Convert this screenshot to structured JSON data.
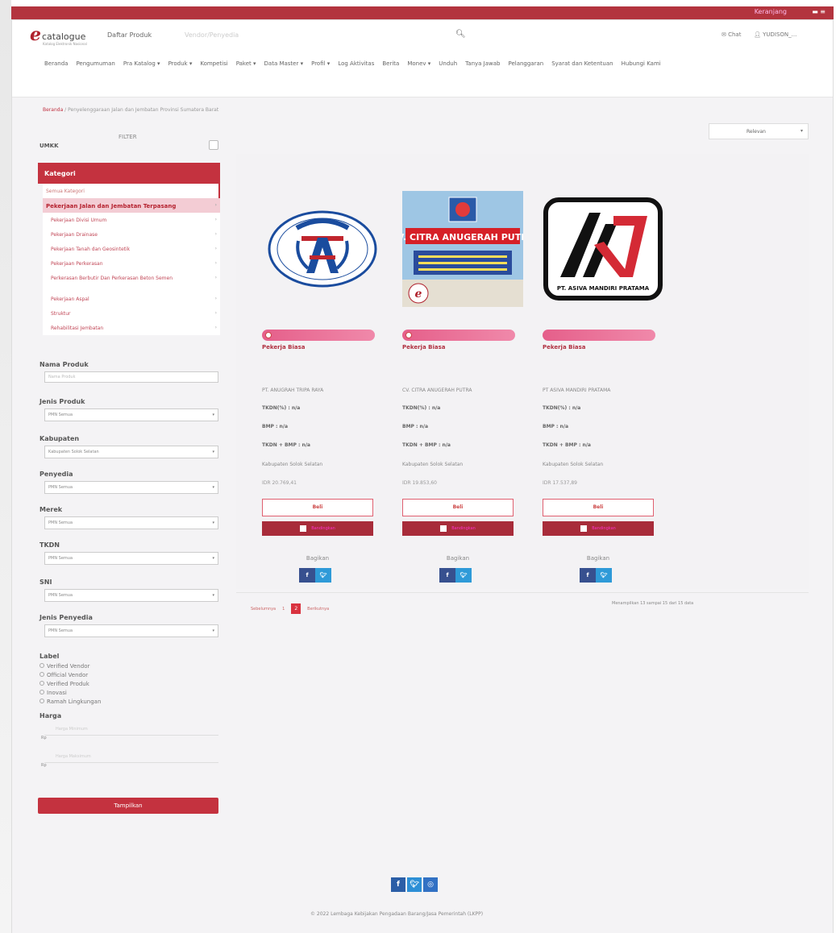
{
  "topbar": {
    "cart": "Keranjang",
    "menu": "▬ ≡"
  },
  "header": {
    "logo_e": "e",
    "logo_text": "catalogue",
    "logo_sub": "Katalog Elektronik Nasional",
    "daftar_produk": "Daftar Produk",
    "faint_link": "Vendor/Penyedia",
    "chat": "Chat",
    "user": "YUDISON_..."
  },
  "nav": [
    "Beranda",
    "Pengumuman",
    "Pra Katalog ▾",
    "Produk ▾",
    "Kompetisi",
    "Paket ▾",
    "Data Master ▾",
    "Profil ▾",
    "Log Aktivitas",
    "Berita",
    "Monev ▾",
    "Unduh",
    "Tanya Jawab",
    "Pelanggaran",
    "Syarat dan Ketentuan",
    "Hubungi Kami"
  ],
  "breadcrumb": {
    "home": "Beranda",
    "sep": " / ",
    "current": "Penyelenggaraan Jalan dan Jembatan Provinsi Sumatera Barat"
  },
  "filter": {
    "title": "FILTER",
    "umkk": "UMKK",
    "kategori_header": "Kategori",
    "kategori": [
      {
        "label": "Semua Kategori",
        "type": "all"
      },
      {
        "label": "Pekerjaan Jalan dan Jembatan Terpasang",
        "type": "selected"
      },
      {
        "label": "Pekerjaan Divisi Umum",
        "type": "sub"
      },
      {
        "label": "Pekerjaan Drainase",
        "type": "sub"
      },
      {
        "label": "Pekerjaan Tanah dan Geosintetik",
        "type": "sub"
      },
      {
        "label": "Pekerjaan Perkerasan",
        "type": "sub"
      },
      {
        "label": "Perkerasan Berbutir Dan Perkerasan Beton Semen",
        "type": "sub-two"
      },
      {
        "label": "Pekerjaan Aspal",
        "type": "sub"
      },
      {
        "label": "Struktur",
        "type": "sub"
      },
      {
        "label": "Rehabilitasi Jembatan",
        "type": "sub"
      }
    ],
    "nama_produk": {
      "label": "Nama Produk",
      "placeholder": "Nama Produk"
    },
    "jenis_produk": {
      "label": "Jenis Produk",
      "value": "PMN Semua"
    },
    "kabupaten": {
      "label": "Kabupaten",
      "value": "Kabupaten Solok Selatan"
    },
    "penyedia": {
      "label": "Penyedia",
      "value": "PMN Semua"
    },
    "merek": {
      "label": "Merek",
      "value": "PMN Semua"
    },
    "tkdn": {
      "label": "TKDN",
      "value": "PMN Semua"
    },
    "sni": {
      "label": "SNI",
      "value": "PMN Semua"
    },
    "jenis_penyedia": {
      "label": "Jenis Penyedia",
      "value": "PMN Semua"
    },
    "label": {
      "title": "Label",
      "options": [
        "Verified Vendor",
        "Official Vendor",
        "Verified Produk",
        "Inovasi",
        "Ramah Lingkungan"
      ]
    },
    "harga": {
      "title": "Harga",
      "min_placeholder": "Harga Minimum",
      "max_placeholder": "Harga Maksimum",
      "rp": "Rp"
    },
    "button": "Tampilkan"
  },
  "sort": {
    "value": "Relevan"
  },
  "products": [
    {
      "logo": "anugrah-tripa-raya-logo",
      "logo_text": "ANUGRAH TRIPA RAYA",
      "type": "Pekerja Biasa",
      "vendor": "PT. ANUGRAH TRIPA RAYA",
      "tkdn_pct": "TKDN(%) : n/a",
      "bmp": "BMP : n/a",
      "tkdn_bmp": "TKDN + BMP : n/a",
      "kabupaten": "Kabupaten Solok Selatan",
      "price": "IDR 20.769,41",
      "buy": "Beli",
      "compare": "Bandingkan",
      "share": "Bagikan"
    },
    {
      "logo": "cv-citra-anugerah-putra-logo",
      "logo_text": "CV. CITRA ANUGERAH PUTRA",
      "type": "Pekerja Biasa",
      "vendor": "CV. CITRA ANUGERAH PUTRA",
      "tkdn_pct": "TKDN(%) : n/a",
      "bmp": "BMP : n/a",
      "tkdn_bmp": "TKDN + BMP : n/a",
      "kabupaten": "Kabupaten Solok Selatan",
      "price": "IDR 19.853,60",
      "buy": "Beli",
      "compare": "Bandingkan",
      "share": "Bagikan"
    },
    {
      "logo": "pt-asiva-mandiri-pratama-logo",
      "logo_text": "PT. ASIVA MANDIRI PRATAMA",
      "type": "Pekerja Biasa",
      "vendor": "PT ASIVA MANDIRI PRATAMA",
      "tkdn_pct": "TKDN(%) : n/a",
      "bmp": "BMP : n/a",
      "tkdn_bmp": "TKDN + BMP : n/a",
      "kabupaten": "Kabupaten Solok Selatan",
      "price": "IDR 17.537,89",
      "buy": "Beli",
      "compare": "Bandingkan",
      "share": "Bagikan"
    }
  ],
  "pagination": {
    "prev": "Sebelumnya",
    "pages": [
      "1",
      "2"
    ],
    "current": "2",
    "next": "Berikutnya",
    "showing": "Menampilkan 13 sampai 15 dari 15 data"
  },
  "footer": {
    "copyright": "© 2022 Lembaga Kebijakan Pengadaan Barang/Jasa Pemerintah (LKPP)"
  },
  "colors": {
    "brand": "#c4323f",
    "dark_brand": "#a82c3a",
    "pink": "#e55f8a",
    "facebook": "#37508f",
    "twitter": "#2e9ad8"
  }
}
